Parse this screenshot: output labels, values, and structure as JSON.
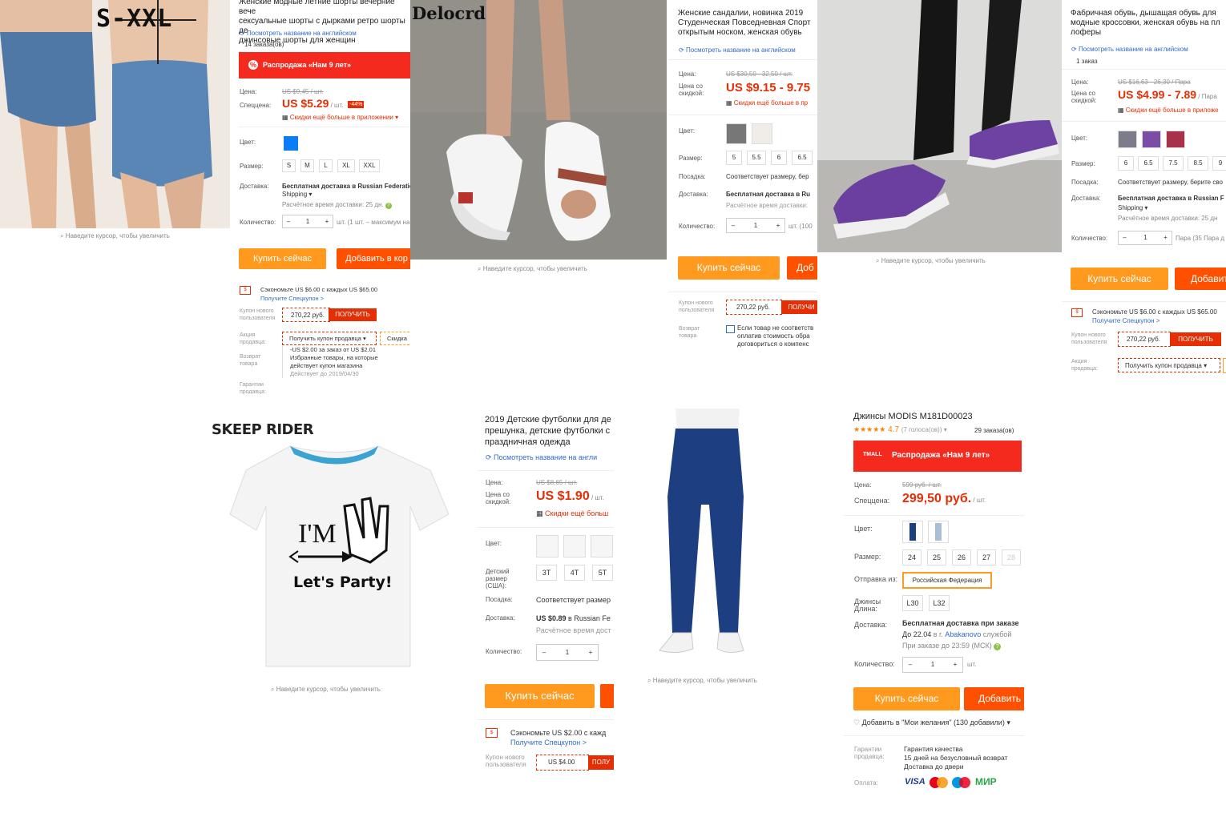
{
  "p1": {
    "watermark": "S-XXL",
    "zoom_hint": "Наведите курсор, чтобы увеличить",
    "title_lines": [
      "Женские модные летние шорты вечерние вече",
      "сексуальные шорты с дырками ретро шорты де",
      "джинсовые шорты для женщин"
    ],
    "english_link": "Посмотреть название на английском",
    "orders": "14 заказа(ов)",
    "sale_banner": "Распродажа «Нам 9 лет»",
    "price_label": "Цена:",
    "old_price": "US $9,45 / шт.",
    "special_label": "Спеццена:",
    "price": "US $5.29",
    "unit": " / шт.",
    "discount": "-44%",
    "app_discount": "Скидки ещё больше в приложении ▾",
    "color_label": "Цвет:",
    "size_label": "Размер:",
    "sizes": [
      "S",
      "M",
      "L",
      "XL",
      "XXL"
    ],
    "delivery_label": "Доставка:",
    "delivery_text": "Бесплатная доставка в Russian Federatio",
    "delivery_method": "Shipping ▾",
    "delivery_time": "Расчётное время доставки: 25 дн.",
    "qty_label": "Количество:",
    "qty_value": "1",
    "qty_note": "шт. (1 шт. – максимум на",
    "buy": "Купить сейчас",
    "add": "Добавить в кор",
    "save_text": "Сэкономьте US $6.00 с каждых US $65.00",
    "get_coupon_link": "Получите Спецкупон >",
    "new_user_label": "Купон нового пользователя",
    "coupon_amount": "270,22 руб.",
    "coupon_get": "ПОЛУЧИТЬ",
    "seller_promo_label": "Акция продавца:",
    "seller_coupon": "Получить купон продавца ▾",
    "seller_discount": "Скидка",
    "return_label": "Возврат товара",
    "promo_lines": [
      "-US $2.00 за заказ от US $2.01",
      "Избранные товары, на которые",
      "действует купон магазина",
      "Действует до 2019/04/30"
    ],
    "guarantee_label": "Гарантии продавца:",
    "color_swatch": "#0a7cf6"
  },
  "p2": {
    "watermark": "Delocrd",
    "zoom_hint": "Наведите курсор, чтобы увеличить",
    "title_lines": [
      "Женские сандалии, новинка 2019",
      "Студенческая Повседневная Спорт",
      "открытым носком, женская обувь"
    ],
    "english_link": "Посмотреть название на английском",
    "price_label": "Цена:",
    "old_price": "US $30,50 - 32,50 / шт.",
    "discount_label": "Цена со скидкой:",
    "price": "US $9.15 - 9.75",
    "app_discount": "Скидки ещё больше в пр",
    "color_label": "Цвет:",
    "size_label": "Размер:",
    "sizes": [
      "5",
      "5.5",
      "6",
      "6.5"
    ],
    "fit_label": "Посадка:",
    "fit_text": "Соответствует размеру, бер",
    "delivery_label": "Доставка:",
    "delivery_text": "Бесплатная доставка в Ru",
    "delivery_time": "Расчётное время доставки:",
    "qty_label": "Количество:",
    "qty_value": "1",
    "qty_note": "шт. (100",
    "buy": "Купить сейчас",
    "add": "Доб",
    "new_user_label": "Купон нового пользователя",
    "coupon_amount": "270,22 руб.",
    "coupon_get": "ПОЛУЧИ",
    "return_label": "Возврат товара",
    "return_lines": [
      "Если товар не соответств",
      "оплатив стоимость обра",
      "договориться о компенс"
    ]
  },
  "p3": {
    "zoom_hint": "Наведите курсор, чтобы увеличить",
    "title_lines": [
      "Фабричная обувь, дышащая обувь для",
      "модные кроссовки, женская обувь на пл",
      "лоферы"
    ],
    "english_link": "Посмотреть название на английском",
    "orders": "1 заказ",
    "price_label": "Цена:",
    "old_price": "US $16,63 - 26,30 / Пара",
    "discount_label": "Цена со скидкой:",
    "price": "US $4.99 - 7.89",
    "unit": " / Пара",
    "app_discount": "Скидки ещё больше в приложе",
    "color_label": "Цвет:",
    "size_label": "Размер:",
    "sizes": [
      "6",
      "6.5",
      "7.5",
      "8.5",
      "9"
    ],
    "fit_label": "Посадка:",
    "fit_text": "Соответствует размеру, берите сво",
    "delivery_label": "Доставка:",
    "delivery_text": "Бесплатная доставка в Russian F",
    "delivery_method": "Shipping ▾",
    "delivery_time": "Расчётное время доставки: 25 дн",
    "qty_label": "Количество:",
    "qty_value": "1",
    "qty_note": "Пара (35 Пара д",
    "buy": "Купить сейчас",
    "add": "Добавит",
    "save_text": "Сэкономьте US $6.00 с каждых US $65.00",
    "get_coupon_link": "Получите Спецкупон >",
    "new_user_label": "Купон нового пользователя",
    "coupon_amount": "270,22 руб.",
    "coupon_get": "ПОЛУЧИТЬ",
    "seller_promo_label": "Акция продавца:",
    "seller_coupon": "Получить купон продавца ▾"
  },
  "p4": {
    "watermark": "SKEEP RIDER",
    "shirt_text_1": "I'M",
    "shirt_text_2": "Let's Party!",
    "zoom_hint": "Наведите курсор, чтобы увеличить",
    "title_lines": [
      "2019 Детские футболки для де",
      "прешунка, детские футболки с",
      "праздничная одежда"
    ],
    "english_link": "Посмотреть название на англи",
    "price_label": "Цена:",
    "old_price": "US $8,65 / шт.",
    "discount_label": "Цена со скидкой:",
    "price": "US $1.90",
    "unit": " / шт.",
    "app_discount": "Скидки ещё больш",
    "color_label": "Цвет:",
    "size_label": "Детский размер (США):",
    "sizes": [
      "3T",
      "4T",
      "5T"
    ],
    "fit_label": "Посадка:",
    "fit_text": "Соответствует размер",
    "delivery_label": "Доставка:",
    "delivery_price": "US $0.89",
    "delivery_text": " в Russian Fe",
    "delivery_time": "Расчётное время дост",
    "qty_label": "Количество:",
    "qty_value": "1",
    "buy": "Купить сейчас",
    "save_text": "Сэкономьте US $2.00 с кажд",
    "get_coupon_link": "Получите Спецкупон >",
    "new_user_label": "Купон нового пользователя",
    "coupon_amount": "US $4.00",
    "coupon_get": "ПОЛУ"
  },
  "p5": {
    "zoom_hint": "Наведите курсор, чтобы увеличить",
    "title": "Джинсы MODIS M181D00023",
    "stars": "★★★★★",
    "rating": "4.7",
    "votes": "(7 голоса(ов)) ▾",
    "orders": "29 заказа(ов)",
    "tmall": "TMALL",
    "sale_banner": "Распродажа «Нам 9 лет»",
    "price_label": "Цена:",
    "old_price": "599 руб. / шт.",
    "special_label": "Спеццена:",
    "price": "299,50 руб.",
    "unit": " / шт.",
    "color_label": "Цвет:",
    "size_label": "Размер:",
    "sizes": [
      "24",
      "25",
      "26",
      "27",
      "28"
    ],
    "ship_from_label": "Отправка из:",
    "ship_from": "Российская Федерация",
    "length_label": "Джинсы Длина:",
    "lengths": [
      "L30",
      "L32"
    ],
    "delivery_label": "Доставка:",
    "delivery_text": "Бесплатная доставка при заказе",
    "delivery_date_pre": "До 22.04",
    "delivery_city_pre": " в г. ",
    "delivery_city": "Abakanovo",
    "delivery_service": " службой",
    "delivery_deadline": "При заказе до 23:59 (МСК)",
    "qty_label": "Количество:",
    "qty_value": "1",
    "qty_unit": "шт.",
    "buy": "Купить сейчас",
    "add": "Добавить",
    "wishlist": "Добавить в \"Мои желания\" (130 добавили) ▾",
    "guarantee_label": "Гарантии продавца:",
    "guarantee_lines": [
      "Гарантия качества",
      "15 дней на безусловный возврат",
      "Доставка до двери"
    ],
    "payment_label": "Оплата:",
    "payments": [
      "VISA",
      "MC",
      "Maestro",
      "МИР"
    ]
  }
}
